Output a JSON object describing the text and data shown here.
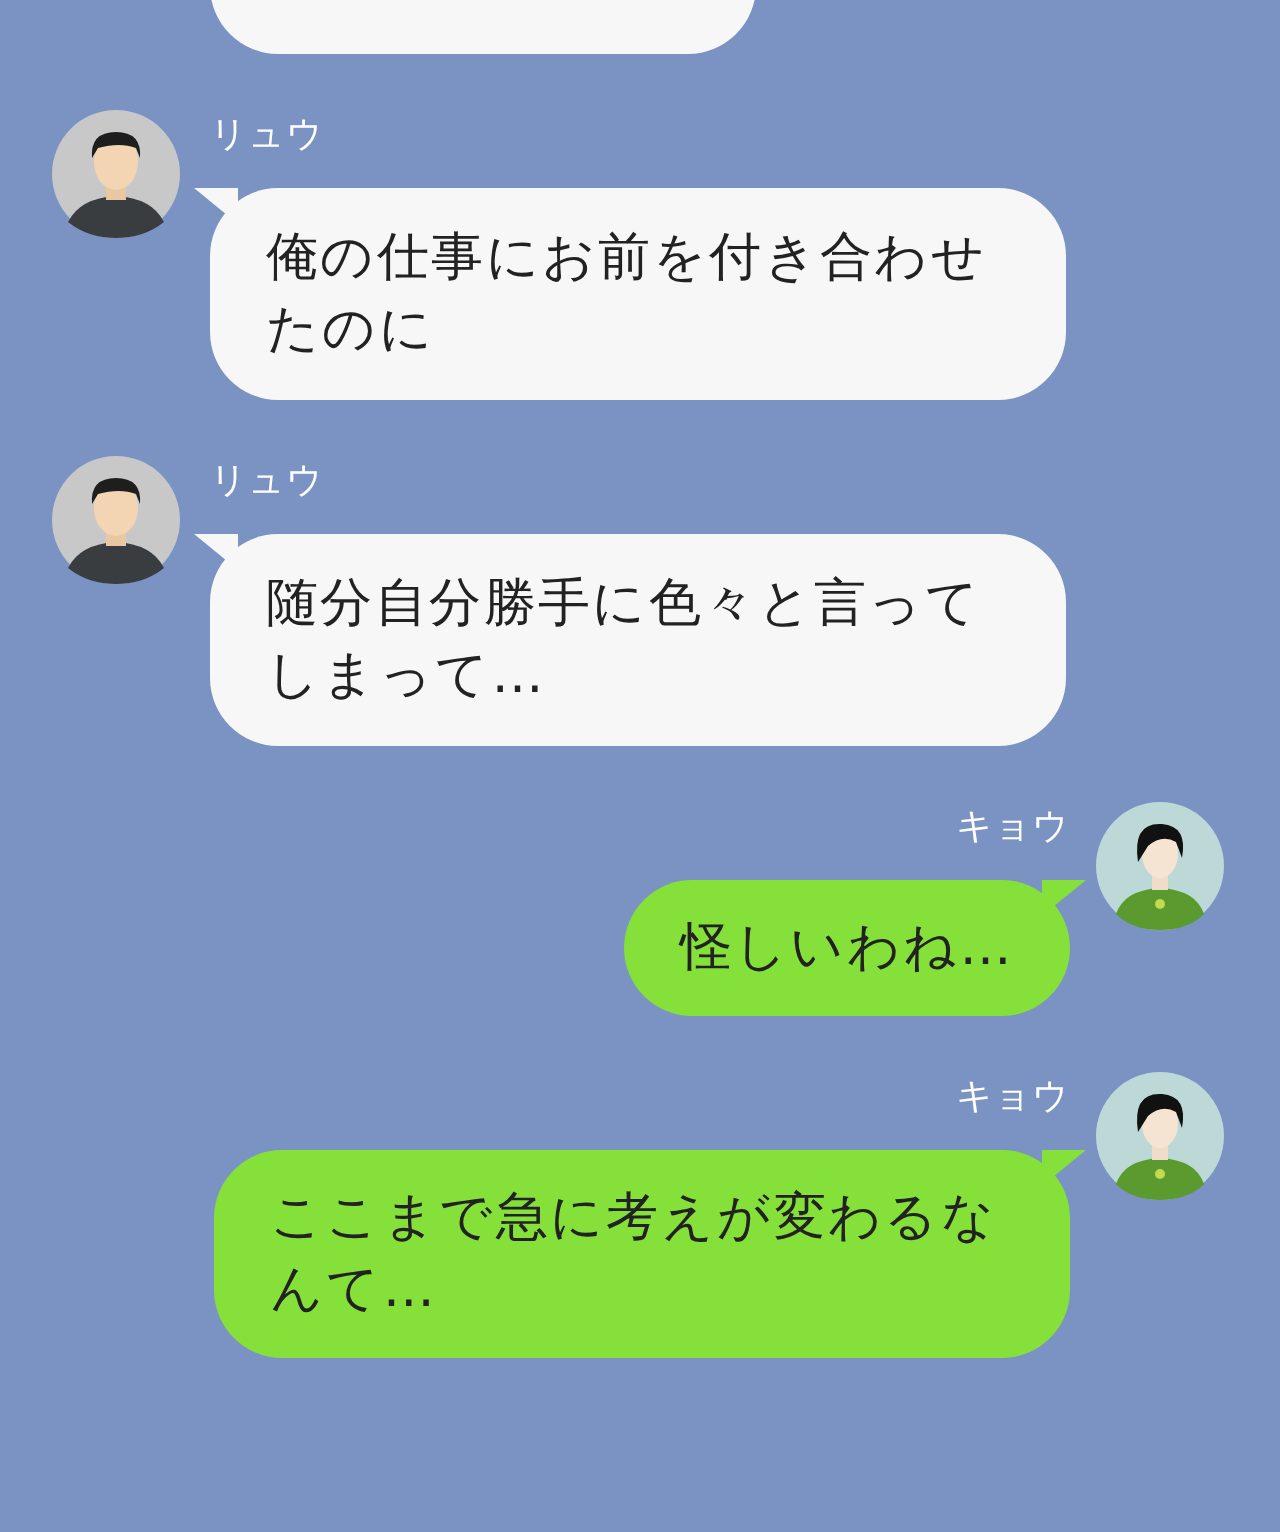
{
  "messages": [
    {
      "kind": "incoming"
    },
    {
      "kind": "incoming",
      "sender": "リュウ",
      "text": "俺の仕事にお前を付き合わせたのに"
    },
    {
      "kind": "incoming",
      "sender": "リュウ",
      "text": "随分自分勝手に色々と言ってしまって…"
    },
    {
      "kind": "outgoing",
      "sender": "キョウ",
      "text": "怪しいわね…"
    },
    {
      "kind": "outgoing",
      "sender": "キョウ",
      "text": "ここまで急に考えが変わるなんて…"
    }
  ]
}
